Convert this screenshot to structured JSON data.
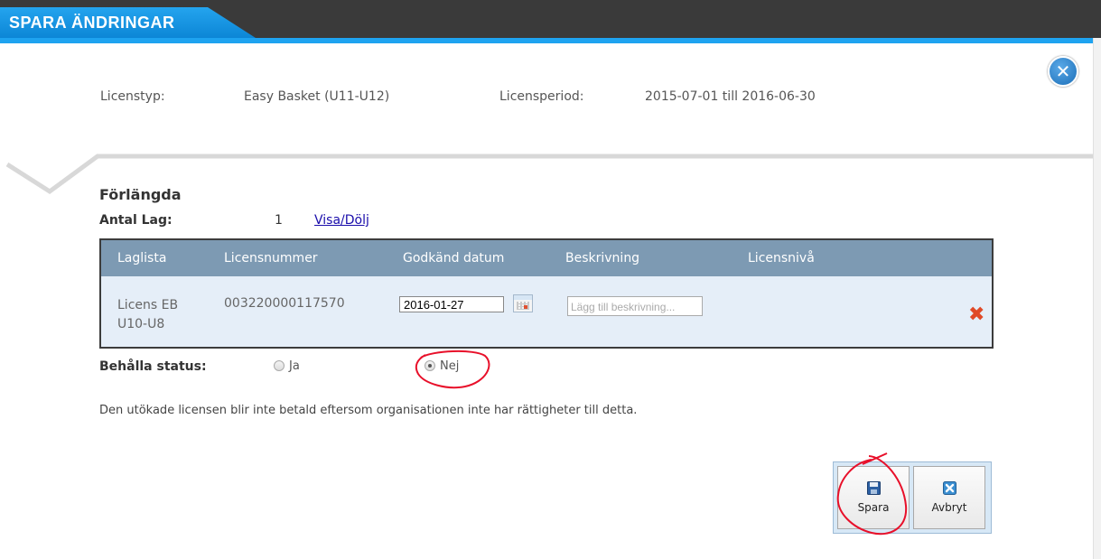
{
  "dialog": {
    "title": "SPARA ÄNDRINGAR",
    "close_icon": "close-x-circle-icon"
  },
  "license_info": {
    "type_label": "Licenstyp:",
    "type_value": "Easy Basket (U11-U12)",
    "period_label": "Licensperiod:",
    "period_value": "2015-07-01 till 2016-06-30"
  },
  "section": {
    "title": "Förlängda",
    "count_label": "Antal Lag:",
    "count_value": "1",
    "toggle_link": "Visa/Dölj"
  },
  "table": {
    "columns": [
      "Laglista",
      "Licensnummer",
      "Godkänd datum",
      "Beskrivning",
      "Licensnivå"
    ],
    "rows": [
      {
        "laglista_line1": "Licens EB",
        "laglista_line2": "U10-U8",
        "licensnummer": "003220000117570",
        "godkand_datum": "2016-01-27",
        "beskrivning_placeholder": "Lägg till beskrivning..."
      }
    ]
  },
  "status": {
    "label": "Behålla status:",
    "options": [
      {
        "label": "Ja",
        "selected": false
      },
      {
        "label": "Nej",
        "selected": true
      }
    ]
  },
  "notice": "Den utökade licensen blir inte betald eftersom organisationen inte har rättigheter till detta.",
  "buttons": {
    "save_label": "Spara",
    "save_icon": "floppy-disk-icon",
    "cancel_label": "Avbryt",
    "cancel_icon": "cancel-x-icon"
  },
  "colors": {
    "accent_blue": "#1ea3f0",
    "table_header": "#7d9ab3",
    "table_row": "#e5eef8",
    "delete_red": "#e04a28",
    "annotation_red": "#e8102a"
  }
}
